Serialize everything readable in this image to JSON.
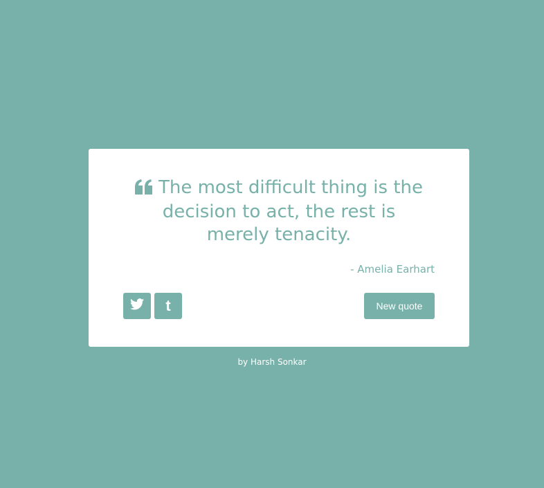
{
  "theme": {
    "background": "#77b1a9",
    "card_background": "#ffffff",
    "accent": "#77b1a9"
  },
  "quote": {
    "text": "The most difficult thing is the decision to act, the rest is merely tenacity.",
    "author": "- Amelia Earhart",
    "icon": "quote-left-icon"
  },
  "actions": {
    "twitter_icon": "twitter-icon",
    "tumblr_icon": "tumblr-icon",
    "new_quote_label": "New quote"
  },
  "footer": {
    "prefix": "by",
    "author": "Harsh Sonkar"
  }
}
